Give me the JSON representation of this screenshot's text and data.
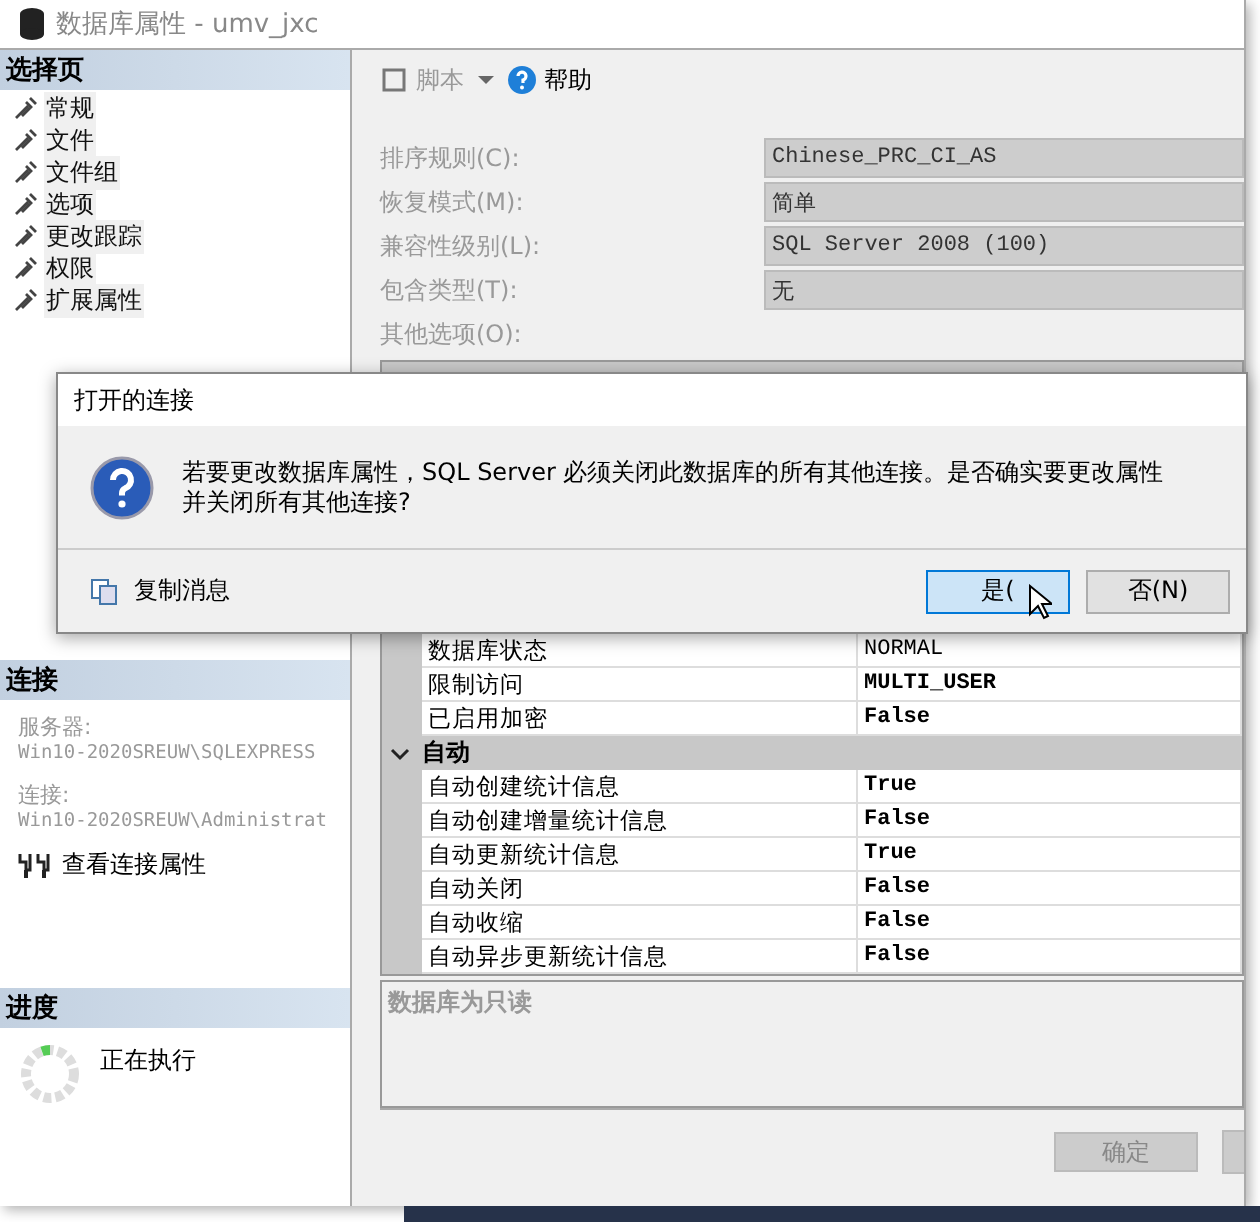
{
  "window": {
    "title": "数据库属性 - umv_jxc"
  },
  "select_page": {
    "header": "选择页",
    "items": [
      {
        "label": "常规"
      },
      {
        "label": "文件"
      },
      {
        "label": "文件组"
      },
      {
        "label": "选项"
      },
      {
        "label": "更改跟踪"
      },
      {
        "label": "权限"
      },
      {
        "label": "扩展属性"
      }
    ]
  },
  "toolbar": {
    "script": "脚本",
    "help": "帮助"
  },
  "properties": [
    {
      "label": "排序规则(C):",
      "value": "Chinese_PRC_CI_AS"
    },
    {
      "label": "恢复模式(M):",
      "value": "简单"
    },
    {
      "label": "兼容性级别(L):",
      "value": "SQL Server 2008 (100)"
    },
    {
      "label": "包含类型(T):",
      "value": "无"
    }
  ],
  "other_options_label": "其他选项(O):",
  "grid": {
    "rows": [
      {
        "kind": "row",
        "name": "数据库状态",
        "value": "NORMAL",
        "bold": false
      },
      {
        "kind": "row",
        "name": "限制访问",
        "value": "MULTI_USER",
        "bold": true
      },
      {
        "kind": "row",
        "name": "已启用加密",
        "value": "False",
        "bold": true
      },
      {
        "kind": "category",
        "name": "自动",
        "expanded": true
      },
      {
        "kind": "row",
        "name": "自动创建统计信息",
        "value": "True",
        "bold": true
      },
      {
        "kind": "row",
        "name": "自动创建增量统计信息",
        "value": "False",
        "bold": true
      },
      {
        "kind": "row",
        "name": "自动更新统计信息",
        "value": "True",
        "bold": true
      },
      {
        "kind": "row",
        "name": "自动关闭",
        "value": "False",
        "bold": true
      },
      {
        "kind": "row",
        "name": "自动收缩",
        "value": "False",
        "bold": true
      },
      {
        "kind": "row",
        "name": "自动异步更新统计信息",
        "value": "False",
        "bold": true
      }
    ]
  },
  "description": "数据库为只读",
  "connection": {
    "header": "连接",
    "server_label": "服务器:",
    "server": "Win10-2020SREUW\\SQLEXPRESS",
    "connection_label": "连接:",
    "connection": "Win10-2020SREUW\\Administrat",
    "view_link": "查看连接属性"
  },
  "progress": {
    "header": "进度",
    "status": "正在执行"
  },
  "buttons": [
    "确定"
  ],
  "dialog": {
    "title": "打开的连接",
    "message": "若要更改数据库属性，SQL Server 必须关闭此数据库的所有其他连接。是否确实要更改属性并关闭所有其他连接?",
    "copy": "复制消息",
    "buttons": [
      {
        "label": "是(",
        "selected": true
      },
      {
        "label": "否(N)",
        "selected": false
      }
    ]
  }
}
